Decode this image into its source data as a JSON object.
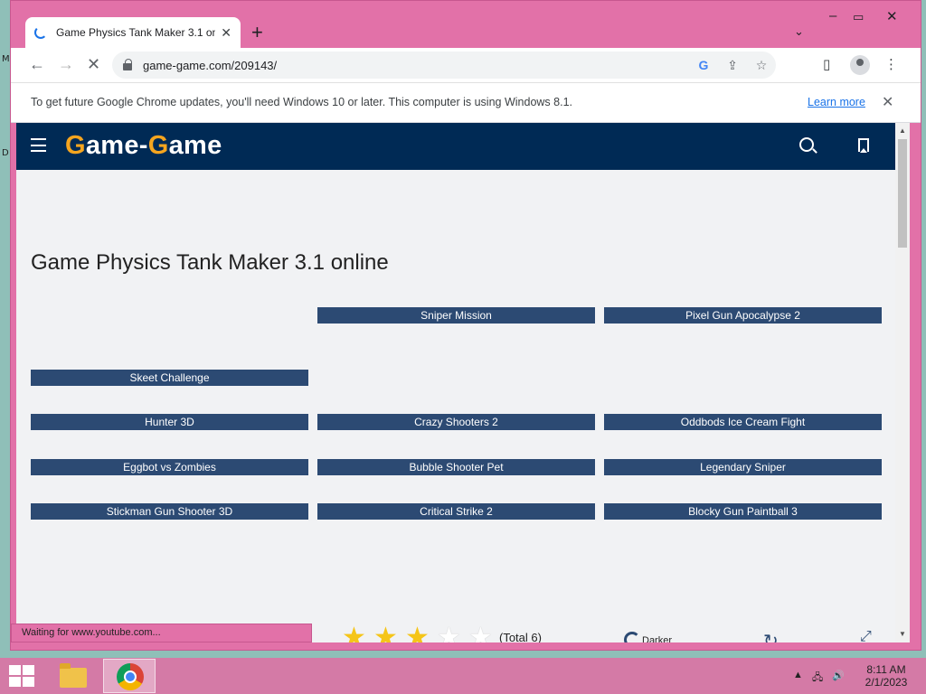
{
  "browser": {
    "tab_title": "Game Physics Tank Maker 3.1 online",
    "url": "game-game.com/209143/",
    "infobar_message": "To get future Google Chrome updates, you'll need Windows 10 or later. This computer is using Windows 8.1.",
    "infobar_link": "Learn more",
    "status_text": "Waiting for www.youtube.com..."
  },
  "site": {
    "logo_parts": [
      "G",
      "ame-",
      "G",
      "ame"
    ],
    "page_title": "Game Physics Tank Maker 3.1 online"
  },
  "games": [
    "Sniper Mission",
    "Pixel Gun Apocalypse 2",
    "Skeet Challenge",
    "Hunter 3D",
    "Crazy Shooters 2",
    "Oddbods Ice Cream Fight",
    "Eggbot vs Zombies",
    "Bubble Shooter Pet",
    "Legendary Sniper",
    "Stickman Gun Shooter 3D",
    "Critical Strike 2",
    "Blocky Gun Paintball 3"
  ],
  "rating": {
    "filled_stars": 3,
    "max_stars": 5,
    "total_text": "(Total 6)"
  },
  "controls": {
    "darker_label": "Darker"
  },
  "taskbar": {
    "time": "8:11 AM",
    "date": "2/1/2023"
  },
  "colors": {
    "header_bg": "#002a55",
    "logo_accent": "#f5a51f",
    "button_bg": "#2c4a73",
    "window_frame": "#e271a8"
  }
}
